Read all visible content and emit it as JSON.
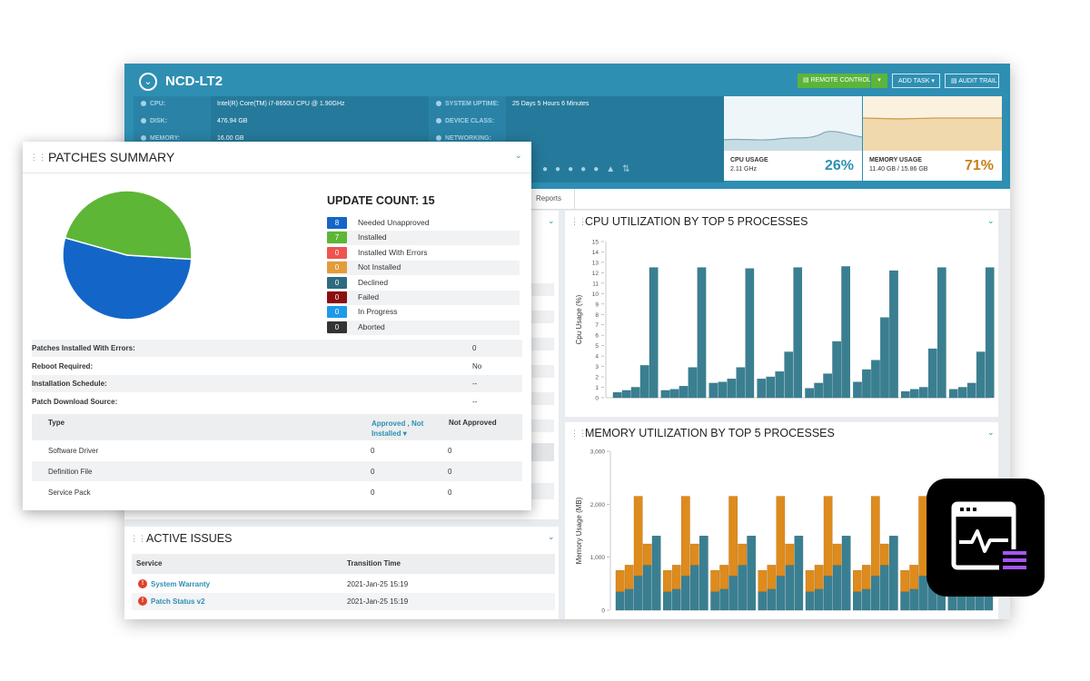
{
  "device": {
    "name": "NCD-LT2"
  },
  "header_buttons": {
    "remote_control": "REMOTE CONTROL",
    "add_task": "ADD TASK",
    "audit_trail": "AUDIT TRAIL"
  },
  "specs": {
    "cpu_label": "CPU:",
    "cpu_value": "Intel(R) Core(TM) i7-8650U CPU @ 1.90GHz",
    "disk_label": "DISK:",
    "disk_value": "476.94 GB",
    "memory_label": "MEMORY:",
    "memory_value": "16.00 GB",
    "uptime_label": "SYSTEM UPTIME:",
    "uptime_value": "25 Days 5 Hours 6 Minutes",
    "device_class_label": "DEVICE CLASS:",
    "networking_label": "NETWORKING:"
  },
  "cpu_tile": {
    "title": "CPU USAGE",
    "sub": "2.11 GHz",
    "pct": "26%",
    "level": 0.26
  },
  "memory_tile": {
    "title": "MEMORY USAGE",
    "sub": "11.40 GB / 15.86 GB",
    "pct": "71%",
    "level": 0.71
  },
  "tabs": {
    "reports": "Reports"
  },
  "patches": {
    "title": "PATCHES SUMMARY",
    "update_count": "UPDATE COUNT: 15",
    "legend": [
      {
        "count": "8",
        "label": "Needed Unapproved",
        "color": "#1366c8"
      },
      {
        "count": "7",
        "label": "Installed",
        "color": "#5db635"
      },
      {
        "count": "0",
        "label": "Installed With Errors",
        "color": "#ef5350"
      },
      {
        "count": "0",
        "label": "Not Installed",
        "color": "#e49b3a"
      },
      {
        "count": "0",
        "label": "Declined",
        "color": "#2f6b80"
      },
      {
        "count": "0",
        "label": "Failed",
        "color": "#8b0e0e"
      },
      {
        "count": "0",
        "label": "In Progress",
        "color": "#1e9ae8"
      },
      {
        "count": "0",
        "label": "Aborted",
        "color": "#333333"
      }
    ],
    "details": [
      {
        "key": "Patches Installed With Errors:",
        "value": "0"
      },
      {
        "key": "Reboot Required:",
        "value": "No"
      },
      {
        "key": "Installation Schedule:",
        "value": "--"
      },
      {
        "key": "Patch Download Source:",
        "value": "--"
      }
    ],
    "table": {
      "headers": [
        "Type",
        "Approved , Not Installed",
        "Not Approved"
      ],
      "rows": [
        {
          "type": "Software Driver",
          "approved": "0",
          "not_approved": "0"
        },
        {
          "type": "Definition File",
          "approved": "0",
          "not_approved": "0"
        },
        {
          "type": "Service Pack",
          "approved": "0",
          "not_approved": "0"
        }
      ]
    }
  },
  "active_issues": {
    "title": "ACTIVE ISSUES",
    "headers": [
      "Service",
      "Transition Time"
    ],
    "rows": [
      {
        "service": "System Warranty",
        "time": "2021-Jan-25 15:19"
      },
      {
        "service": "Patch Status v2",
        "time": "2021-Jan-25 15:19"
      }
    ]
  },
  "chart_data": [
    {
      "type": "pie",
      "categories": [
        "Needed Unapproved",
        "Installed"
      ],
      "values": [
        8,
        7
      ],
      "colors": [
        "#1366c8",
        "#5db635"
      ]
    },
    {
      "type": "bar",
      "title": "CPU UTILIZATION BY TOP 5 PROCESSES",
      "ylabel": "Cpu Usage (%)",
      "ylim": [
        0,
        15
      ],
      "yticks": [
        "0",
        "1",
        "2",
        "3",
        "4",
        "5",
        "6",
        "7",
        "8",
        "9",
        "10",
        "11",
        "12",
        "13",
        "14",
        "15"
      ],
      "color": "#3a7f91",
      "groups": [
        [
          0.5,
          0.7,
          1.0,
          3.1,
          12.5
        ],
        [
          0.7,
          0.8,
          1.1,
          2.9,
          12.5
        ],
        [
          1.4,
          1.5,
          1.8,
          2.9,
          12.4
        ],
        [
          1.8,
          2.0,
          2.5,
          4.4,
          12.5
        ],
        [
          0.9,
          1.4,
          2.3,
          5.4,
          12.6
        ],
        [
          1.5,
          2.7,
          3.6,
          7.7,
          12.2
        ],
        [
          0.6,
          0.8,
          1.0,
          4.7,
          12.5
        ],
        [
          0.8,
          1.0,
          1.4,
          4.4,
          12.5
        ]
      ]
    },
    {
      "type": "bar",
      "title": "MEMORY UTILIZATION BY TOP 5 PROCESSES",
      "ylabel": "Memory Usage (MB)",
      "ylim": [
        0,
        3000
      ],
      "yticks": [
        "0",
        "1,000",
        "2,000",
        "3,000"
      ],
      "colors": [
        "#3a7f91",
        "#de8b1d"
      ],
      "groups": [
        [
          {
            "base": 350,
            "top": 750
          },
          {
            "base": 400,
            "top": 850
          },
          {
            "base": 650,
            "top": 2150
          },
          {
            "base": 850,
            "top": 1250
          },
          {
            "base": 1400,
            "top": 1400
          }
        ],
        [
          {
            "base": 350,
            "top": 750
          },
          {
            "base": 400,
            "top": 850
          },
          {
            "base": 650,
            "top": 2150
          },
          {
            "base": 850,
            "top": 1250
          },
          {
            "base": 1400,
            "top": 1400
          }
        ],
        [
          {
            "base": 350,
            "top": 750
          },
          {
            "base": 400,
            "top": 850
          },
          {
            "base": 650,
            "top": 2150
          },
          {
            "base": 850,
            "top": 1250
          },
          {
            "base": 1400,
            "top": 1400
          }
        ],
        [
          {
            "base": 350,
            "top": 750
          },
          {
            "base": 400,
            "top": 850
          },
          {
            "base": 650,
            "top": 2150
          },
          {
            "base": 850,
            "top": 1250
          },
          {
            "base": 1400,
            "top": 1400
          }
        ],
        [
          {
            "base": 350,
            "top": 750
          },
          {
            "base": 400,
            "top": 850
          },
          {
            "base": 650,
            "top": 2150
          },
          {
            "base": 850,
            "top": 1250
          },
          {
            "base": 1400,
            "top": 1400
          }
        ],
        [
          {
            "base": 350,
            "top": 750
          },
          {
            "base": 400,
            "top": 850
          },
          {
            "base": 650,
            "top": 2150
          },
          {
            "base": 850,
            "top": 1250
          },
          {
            "base": 1400,
            "top": 1400
          }
        ],
        [
          {
            "base": 350,
            "top": 750
          },
          {
            "base": 400,
            "top": 850
          },
          {
            "base": 650,
            "top": 2150
          },
          {
            "base": 850,
            "top": 1250
          },
          {
            "base": 1400,
            "top": 1400
          }
        ],
        [
          {
            "base": 350,
            "top": 750
          },
          {
            "base": 400,
            "top": 850
          },
          {
            "base": 650,
            "top": 2150
          },
          {
            "base": 850,
            "top": 1250
          },
          {
            "base": 1400,
            "top": 1400
          }
        ]
      ]
    }
  ]
}
